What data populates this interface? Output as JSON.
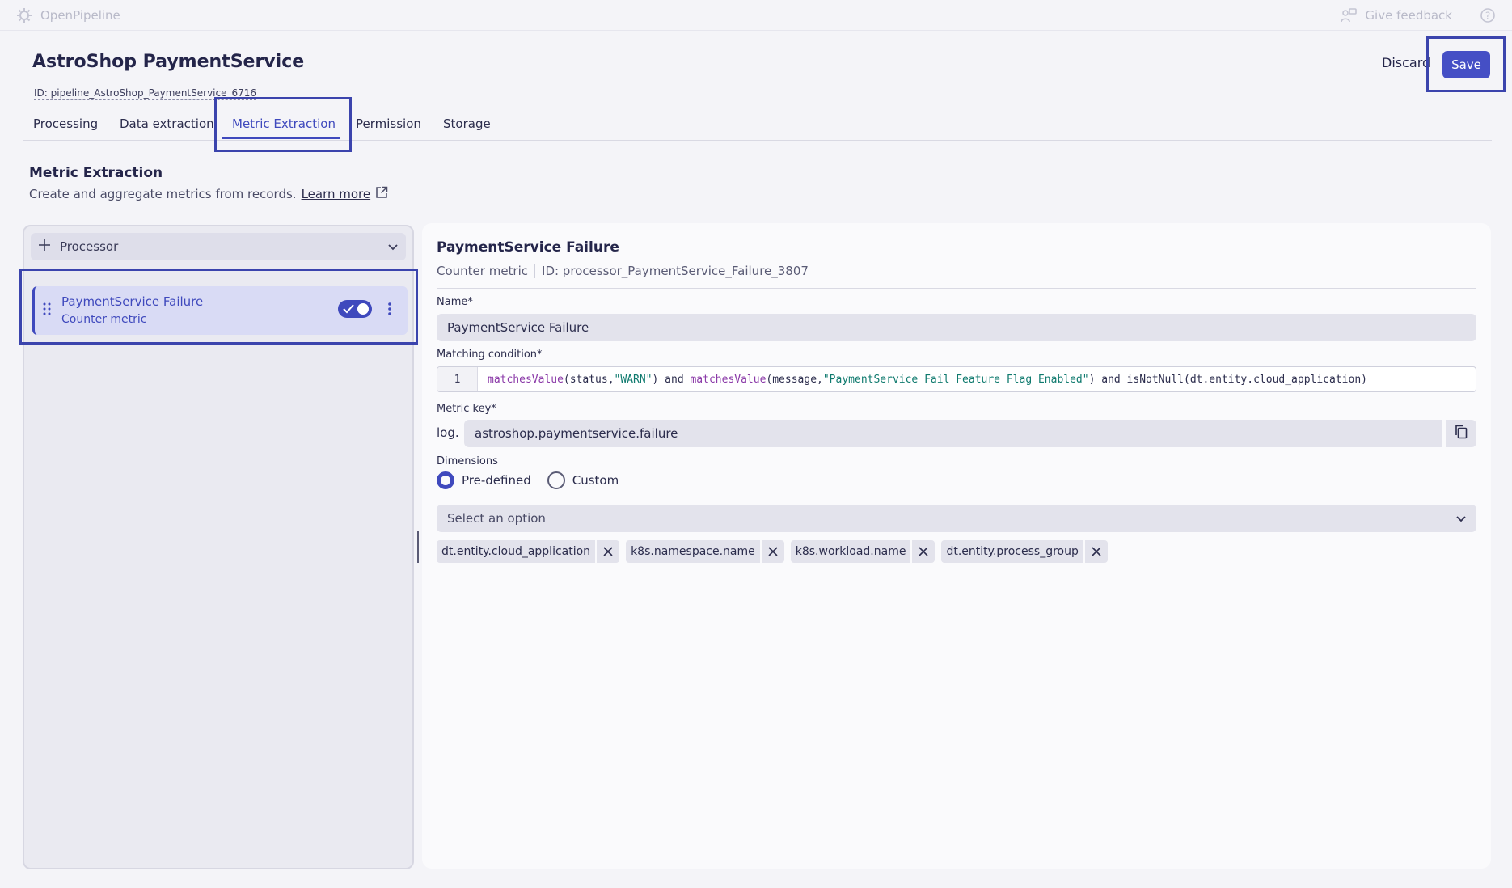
{
  "topbar": {
    "app_name": "OpenPipeline",
    "feedback_label": "Give feedback",
    "app_icon": "openpipeline-icon",
    "feedback_icon": "feedback-icon",
    "help_icon": "help-icon"
  },
  "header": {
    "title": "AstroShop PaymentService",
    "pipeline_id": "ID: pipeline_AstroShop_PaymentService_6716",
    "discard_label": "Discard",
    "save_label": "Save"
  },
  "tabs": [
    {
      "label": "Processing",
      "active": false
    },
    {
      "label": "Data extraction",
      "active": false
    },
    {
      "label": "Metric Extraction",
      "active": true
    },
    {
      "label": "Permission",
      "active": false
    },
    {
      "label": "Storage",
      "active": false
    }
  ],
  "section": {
    "title": "Metric Extraction",
    "description": "Create and aggregate metrics from records.",
    "learn_more": "Learn more"
  },
  "processor_list": {
    "add_label": "Processor",
    "items": [
      {
        "name": "PaymentService Failure",
        "type": "Counter metric",
        "enabled": true
      }
    ]
  },
  "detail": {
    "title": "PaymentService Failure",
    "type": "Counter metric",
    "processor_id": "ID: processor_PaymentService_Failure_3807",
    "name_label": "Name*",
    "name_value": "PaymentService Failure",
    "condition_label": "Matching condition*",
    "condition_line": "1",
    "condition": {
      "p1": "matchesValue",
      "p2": "(status,",
      "p3": "\"WARN\"",
      "p4": ") and ",
      "p5": "matchesValue",
      "p6": "(message,",
      "p7": "\"PaymentService Fail Feature Flag Enabled\"",
      "p8": ") and isNotNull(dt.entity.cloud_application)"
    },
    "metric_key_label": "Metric key*",
    "metric_key_prefix": "log.",
    "metric_key_value": "astroshop.paymentservice.failure",
    "dimensions_label": "Dimensions",
    "dimension_modes": [
      "Pre-defined",
      "Custom"
    ],
    "dimension_mode_selected": "Pre-defined",
    "select_placeholder": "Select an option",
    "dimensions": [
      "dt.entity.cloud_application",
      "k8s.namespace.name",
      "k8s.workload.name",
      "dt.entity.process_group"
    ]
  },
  "colors": {
    "accent": "#3f49bd",
    "save_button": "#454fc5",
    "highlight_frame": "#3b44ad"
  }
}
